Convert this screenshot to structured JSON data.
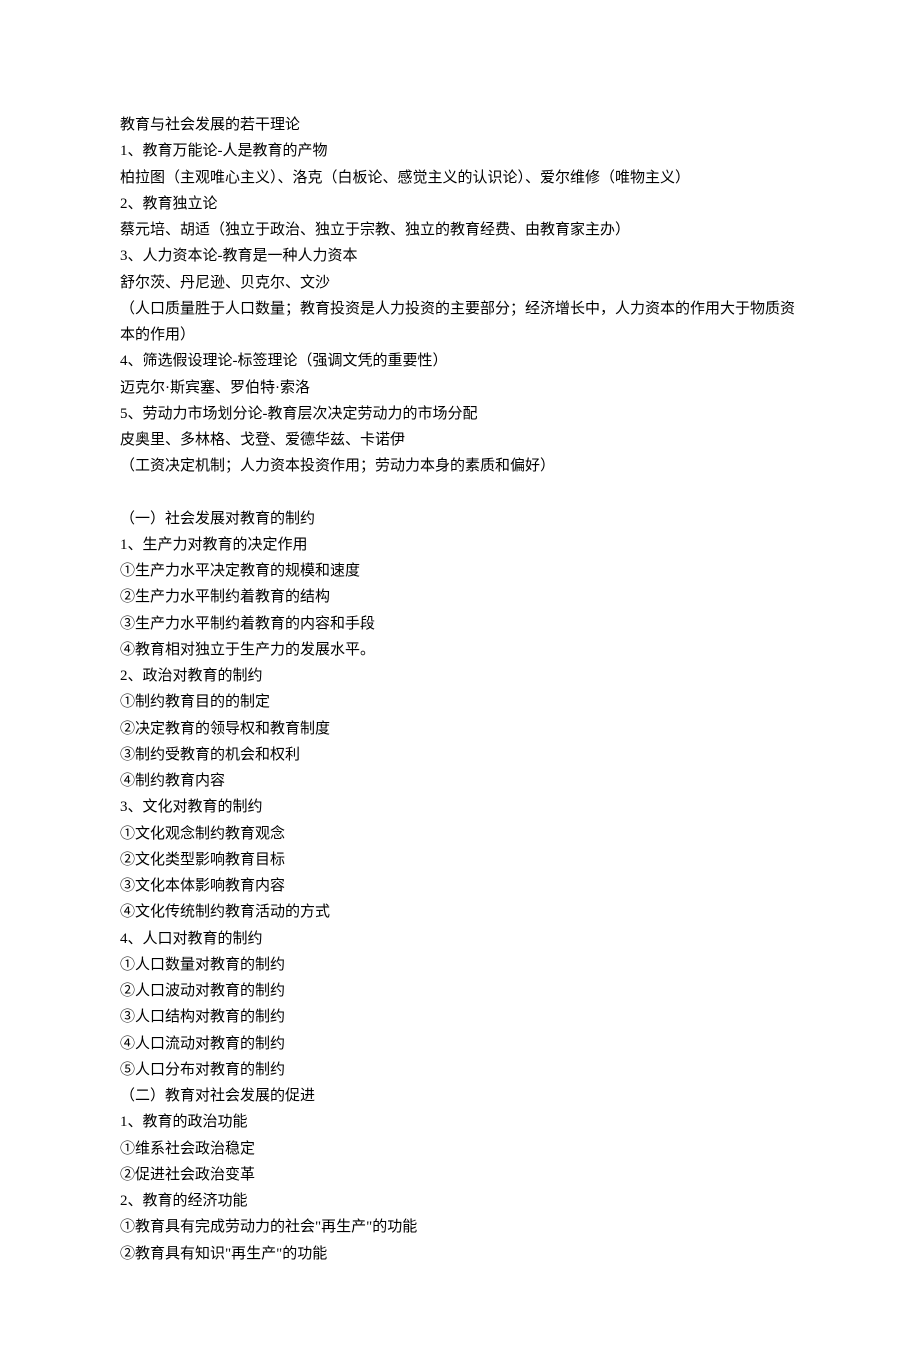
{
  "lines": [
    "教育与社会发展的若干理论",
    "1、教育万能论-人是教育的产物",
    "柏拉图（主观唯心主义）、洛克（白板论、感觉主义的认识论）、爱尔维修（唯物主义）",
    "2、教育独立论",
    "蔡元培、胡适（独立于政治、独立于宗教、独立的教育经费、由教育家主办）",
    "3、人力资本论-教育是一种人力资本",
    "舒尔茨、丹尼逊、贝克尔、文沙",
    "（人口质量胜于人口数量；教育投资是人力投资的主要部分；经济增长中，人力资本的作用大于物质资本的作用）",
    "4、筛选假设理论-标签理论（强调文凭的重要性）",
    "迈克尔·斯宾塞、罗伯特·索洛",
    "5、劳动力市场划分论-教育层次决定劳动力的市场分配",
    "皮奥里、多林格、戈登、爱德华兹、卡诺伊",
    "（工资决定机制；人力资本投资作用；劳动力本身的素质和偏好）",
    "",
    "（一）社会发展对教育的制约",
    "1、生产力对教育的决定作用",
    "①生产力水平决定教育的规模和速度",
    "②生产力水平制约着教育的结构",
    "③生产力水平制约着教育的内容和手段",
    "④教育相对独立于生产力的发展水平。",
    "2、政治对教育的制约",
    "①制约教育目的的制定",
    "②决定教育的领导权和教育制度",
    "③制约受教育的机会和权利",
    "④制约教育内容",
    "3、文化对教育的制约",
    "①文化观念制约教育观念",
    "②文化类型影响教育目标",
    "③文化本体影响教育内容",
    "④文化传统制约教育活动的方式",
    "4、人口对教育的制约",
    "①人口数量对教育的制约",
    "②人口波动对教育的制约",
    "③人口结构对教育的制约",
    "④人口流动对教育的制约",
    "⑤人口分布对教育的制约",
    "（二）教育对社会发展的促进",
    "1、教育的政治功能",
    "①维系社会政治稳定",
    "②促进社会政治变革",
    "2、教育的经济功能",
    "①教育具有完成劳动力的社会\"再生产\"的功能",
    "②教育具有知识\"再生产\"的功能"
  ]
}
